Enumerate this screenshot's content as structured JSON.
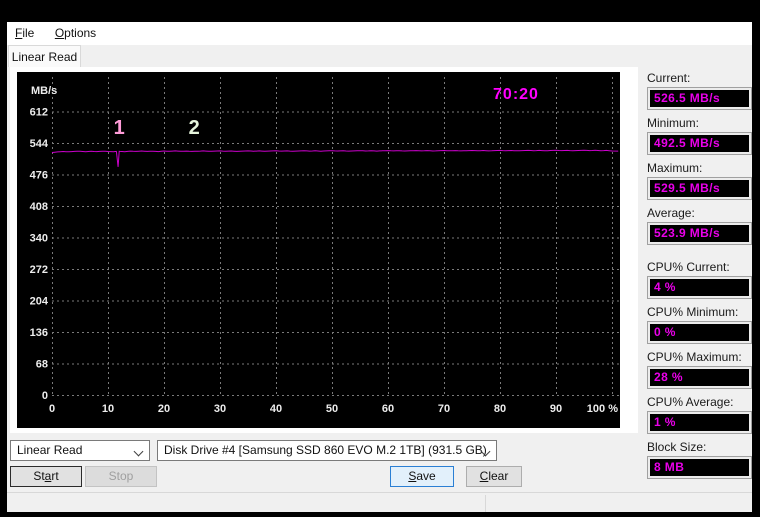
{
  "window": {
    "menu": [
      {
        "label": "File",
        "accel": "F"
      },
      {
        "label": "Options",
        "accel": "O"
      }
    ],
    "tab_label": "Linear Read"
  },
  "stats": [
    {
      "label": "Current:",
      "value": "526.5 MB/s"
    },
    {
      "label": "Minimum:",
      "value": "492.5 MB/s"
    },
    {
      "label": "Maximum:",
      "value": "529.5 MB/s"
    },
    {
      "label": "Average:",
      "value": "523.9 MB/s"
    },
    {
      "label": "CPU% Current:",
      "value": "4 %"
    },
    {
      "label": "CPU% Minimum:",
      "value": "0 %"
    },
    {
      "label": "CPU% Maximum:",
      "value": "28 %"
    },
    {
      "label": "CPU% Average:",
      "value": "1 %"
    },
    {
      "label": "Block Size:",
      "value": "8 MB"
    }
  ],
  "controls": {
    "test_type": "Linear Read",
    "drive": "Disk Drive #4  [Samsung SSD 860 EVO M.2 1TB]  (931.5 GB)",
    "start": {
      "label": "Start",
      "accel": "a"
    },
    "stop": {
      "label": "Stop",
      "accel": ""
    },
    "save": {
      "label": "Save",
      "accel": "S"
    },
    "clear": {
      "label": "Clear",
      "accel": "C"
    }
  },
  "chart_data": {
    "type": "line",
    "ylabel": "MB/s",
    "ylim": [
      0,
      680
    ],
    "yticks": [
      612,
      544,
      476,
      408,
      340,
      272,
      204,
      136,
      68,
      0
    ],
    "xticks": [
      "0",
      "10",
      "20",
      "30",
      "40",
      "50",
      "60",
      "70",
      "80",
      "90",
      "100 %"
    ],
    "x_range_percent": [
      0,
      100
    ],
    "x_step_percent": 1,
    "values": [
      523.5,
      524.8,
      525.6,
      524.9,
      525.8,
      526.2,
      525.1,
      526.0,
      525.4,
      526.3,
      525.7,
      525.2,
      526.1,
      525.3,
      526.4,
      525.8,
      526.6,
      525.9,
      526.2,
      525.5,
      526.7,
      526.0,
      526.9,
      526.1,
      526.5,
      525.8,
      526.3,
      526.8,
      526.0,
      526.4,
      526.9,
      526.2,
      526.6,
      525.9,
      526.5,
      527.0,
      526.3,
      526.8,
      526.1,
      526.6,
      527.1,
      526.4,
      526.9,
      526.2,
      526.7,
      527.2,
      526.5,
      527.0,
      526.3,
      526.8,
      527.3,
      526.6,
      527.1,
      526.4,
      526.9,
      527.4,
      526.7,
      527.2,
      526.5,
      527.0,
      527.5,
      526.8,
      527.3,
      526.6,
      527.1,
      527.6,
      526.9,
      527.4,
      526.7,
      527.2,
      527.7,
      527.0,
      527.5,
      526.8,
      527.3,
      527.8,
      527.1,
      527.6,
      526.9,
      527.4,
      527.9,
      527.2,
      527.7,
      527.0,
      527.5,
      528.0,
      527.3,
      527.8,
      527.1,
      527.6,
      528.1,
      527.4,
      527.9,
      527.2,
      527.7,
      528.2,
      527.5,
      528.0,
      527.3,
      527.8,
      526.5
    ],
    "dips": [
      {
        "pct": 11.8,
        "value": 492.5,
        "width_pct": 0.7
      }
    ],
    "markers": [
      {
        "label": "1",
        "pct": 12.0,
        "color": "#ff9cd8"
      },
      {
        "label": "2",
        "pct": 25.4,
        "color": "#e6f5dc"
      }
    ],
    "time_label": {
      "text": "70:20",
      "color": "#ff00ff"
    },
    "line_color": "#cc00cc",
    "grid": true,
    "grid_color": "#7a7a7a",
    "bg": "#000000",
    "tick_color": "#ededed"
  }
}
